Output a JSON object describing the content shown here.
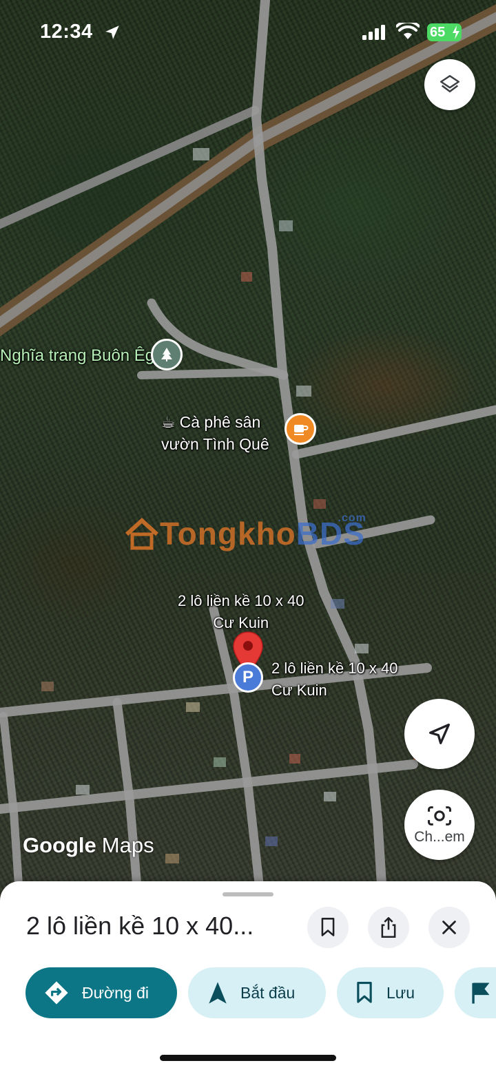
{
  "status_bar": {
    "time": "12:34",
    "battery": "65"
  },
  "map": {
    "places": {
      "cemetery": "Nghĩa trang Buôn Êga",
      "cafe_line1": "Cà phê sân",
      "cafe_line2": "vườn Tình Quê"
    },
    "watermark": {
      "part1": "Tongkho",
      "part2": "BDS",
      "suffix": ".com"
    },
    "listing_label_a": {
      "line1": "2 lô liền kề 10 x 40",
      "line2": "Cư Kuin"
    },
    "listing_label_b": {
      "line1": "2 lô liền kề 10 x 40",
      "line2": "Cư Kuin"
    },
    "parking_letter": "P",
    "camera_label": "Ch...em",
    "logo": {
      "google": "Google",
      "maps": "Maps"
    },
    "icons": [
      "layers-icon",
      "navigation-arrow-icon",
      "camera-search-icon",
      "cemetery-icon",
      "cafe-icon",
      "red-location-pin-icon",
      "parking-icon"
    ]
  },
  "sheet": {
    "title": "2 lô liền kề 10 x 40...",
    "actions": {
      "directions": "Đường đi",
      "start": "Bắt đầu",
      "save": "Lưu"
    }
  },
  "colors": {
    "primary_chip": "#0d7686",
    "secondary_chip": "#d7f0f6",
    "pin_red": "#e53935",
    "cafe_orange": "#f08a24",
    "parking_blue": "#4b7bd8"
  }
}
